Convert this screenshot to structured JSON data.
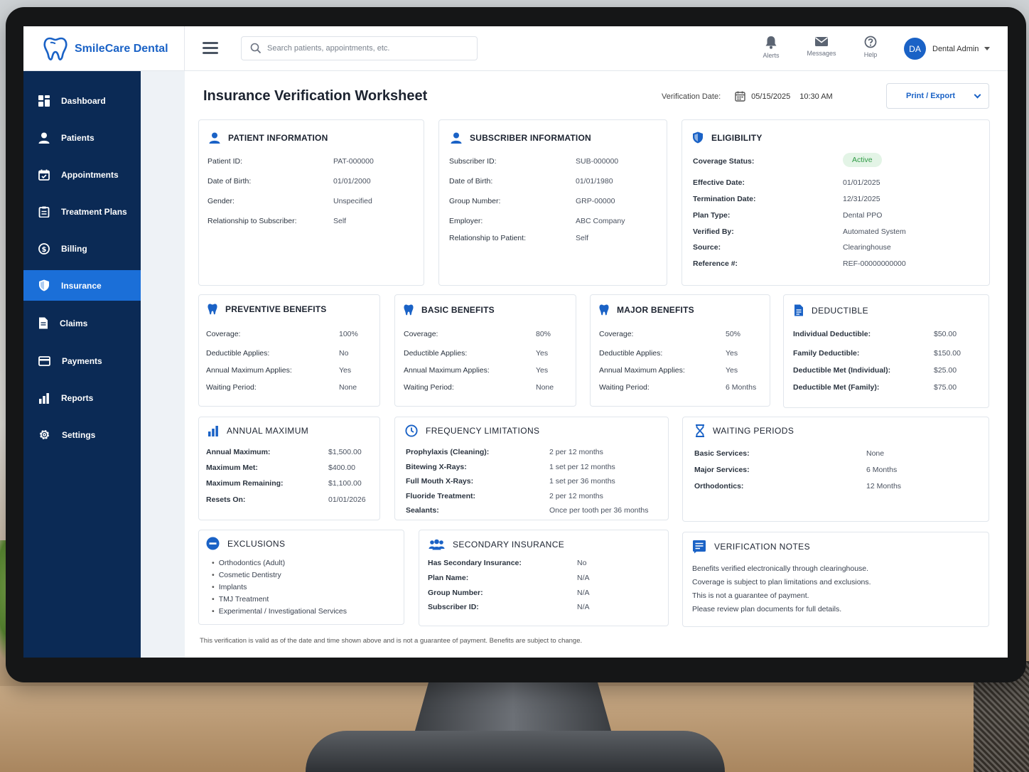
{
  "app": {
    "name": "SmileCare Dental"
  },
  "search": {
    "placeholder": "Search patients, appointments, etc."
  },
  "topbar": {
    "alerts_label": "Alerts",
    "messages_label": "Messages",
    "help_label": "Help",
    "user_initials": "DA",
    "user_name": "Dental Admin"
  },
  "sidebar": {
    "items": [
      {
        "label": "Dashboard",
        "icon": "dashboard-icon"
      },
      {
        "label": "Patients",
        "icon": "user-icon"
      },
      {
        "label": "Appointments",
        "icon": "calendar-icon"
      },
      {
        "label": "Treatment Plans",
        "icon": "clipboard-icon"
      },
      {
        "label": "Billing",
        "icon": "dollar-icon"
      },
      {
        "label": "Insurance",
        "icon": "shield-icon",
        "active": true
      },
      {
        "label": "Claims",
        "icon": "document-icon"
      },
      {
        "label": "Payments",
        "icon": "credit-card-icon"
      },
      {
        "label": "Reports",
        "icon": "bar-chart-icon"
      },
      {
        "label": "Settings",
        "icon": "gear-icon"
      }
    ]
  },
  "header": {
    "title": "Insurance Verification Worksheet",
    "verification_label": "Verification Date:",
    "verification_date": "05/15/2025",
    "verification_time": "10:30 AM",
    "export_label": "Print / Export"
  },
  "patient": {
    "title": "PATIENT INFORMATION",
    "rows": [
      {
        "k": "Patient ID:",
        "v": "PAT-000000"
      },
      {
        "k": "Date of Birth:",
        "v": "01/01/2000"
      },
      {
        "k": "Gender:",
        "v": "Unspecified"
      },
      {
        "k": "Relationship to Subscriber:",
        "v": "Self"
      }
    ]
  },
  "subscriber": {
    "title": "SUBSCRIBER INFORMATION",
    "rows": [
      {
        "k": "Subscriber ID:",
        "v": "SUB-000000"
      },
      {
        "k": "Date of Birth:",
        "v": "01/01/1980"
      },
      {
        "k": "Group Number:",
        "v": "GRP-00000"
      },
      {
        "k": "Employer:",
        "v": "ABC Company"
      },
      {
        "k": "Relationship to Patient:",
        "v": "Self"
      }
    ]
  },
  "eligibility": {
    "title": "ELIGIBILITY",
    "coverage_status_label": "Coverage Status:",
    "coverage_status": "Active",
    "rows": [
      {
        "k": "Effective Date:",
        "v": "01/01/2025"
      },
      {
        "k": "Termination Date:",
        "v": "12/31/2025"
      },
      {
        "k": "Plan Type:",
        "v": "Dental PPO"
      },
      {
        "k": "Verified By:",
        "v": "Automated System"
      },
      {
        "k": "Source:",
        "v": "Clearinghouse"
      },
      {
        "k": "Reference #:",
        "v": "REF-00000000000"
      }
    ]
  },
  "preventive": {
    "title": "PREVENTIVE BENEFITS",
    "rows": [
      {
        "k": "Coverage:",
        "v": "100%"
      },
      {
        "k": "Deductible Applies:",
        "v": "No"
      },
      {
        "k": "Annual Maximum Applies:",
        "v": "Yes"
      },
      {
        "k": "Waiting Period:",
        "v": "None"
      }
    ]
  },
  "basic": {
    "title": "BASIC BENEFITS",
    "rows": [
      {
        "k": "Coverage:",
        "v": "80%"
      },
      {
        "k": "Deductible Applies:",
        "v": "Yes"
      },
      {
        "k": "Annual Maximum Applies:",
        "v": "Yes"
      },
      {
        "k": "Waiting Period:",
        "v": "None"
      }
    ]
  },
  "major": {
    "title": "MAJOR BENEFITS",
    "rows": [
      {
        "k": "Coverage:",
        "v": "50%"
      },
      {
        "k": "Deductible Applies:",
        "v": "Yes"
      },
      {
        "k": "Annual Maximum Applies:",
        "v": "Yes"
      },
      {
        "k": "Waiting Period:",
        "v": "6 Months"
      }
    ]
  },
  "deductible": {
    "title": "DEDUCTIBLE",
    "rows": [
      {
        "k": "Individual Deductible:",
        "v": "$50.00"
      },
      {
        "k": "Family Deductible:",
        "v": "$150.00"
      },
      {
        "k": "Deductible Met (Individual):",
        "v": "$25.00"
      },
      {
        "k": "Deductible Met (Family):",
        "v": "$75.00"
      }
    ]
  },
  "annual_max": {
    "title": "ANNUAL MAXIMUM",
    "rows": [
      {
        "k": "Annual Maximum:",
        "v": "$1,500.00"
      },
      {
        "k": "Maximum Met:",
        "v": "$400.00"
      },
      {
        "k": "Maximum Remaining:",
        "v": "$1,100.00"
      },
      {
        "k": "Resets On:",
        "v": "01/01/2026"
      }
    ]
  },
  "frequency": {
    "title": "FREQUENCY LIMITATIONS",
    "rows": [
      {
        "k": "Prophylaxis (Cleaning):",
        "v": "2 per 12 months"
      },
      {
        "k": "Bitewing X-Rays:",
        "v": "1 set per 12 months"
      },
      {
        "k": "Full Mouth X-Rays:",
        "v": "1 set per 36 months"
      },
      {
        "k": "Fluoride Treatment:",
        "v": "2 per 12 months"
      },
      {
        "k": "Sealants:",
        "v": "Once per tooth per 36 months"
      }
    ]
  },
  "waiting": {
    "title": "WAITING PERIODS",
    "rows": [
      {
        "k": "Basic Services:",
        "v": "None"
      },
      {
        "k": "Major Services:",
        "v": "6 Months"
      },
      {
        "k": "Orthodontics:",
        "v": "12 Months"
      }
    ]
  },
  "exclusions": {
    "title": "EXCLUSIONS",
    "items": [
      "Orthodontics (Adult)",
      "Cosmetic Dentistry",
      "Implants",
      "TMJ Treatment",
      "Experimental / Investigational Services"
    ]
  },
  "secondary": {
    "title": "SECONDARY INSURANCE",
    "rows": [
      {
        "k": "Has Secondary Insurance:",
        "v": "No"
      },
      {
        "k": "Plan Name:",
        "v": "N/A"
      },
      {
        "k": "Group Number:",
        "v": "N/A"
      },
      {
        "k": "Subscriber ID:",
        "v": "N/A"
      }
    ]
  },
  "notes": {
    "title": "VERIFICATION NOTES",
    "lines": [
      "Benefits verified electronically through clearinghouse.",
      "Coverage is subject to plan limitations and exclusions.",
      "This is not a guarantee of payment.",
      "Please review plan documents for full details."
    ]
  },
  "footnote": "This verification is valid as of the date and time shown above and is not a guarantee of payment. Benefits are subject to change.",
  "colors": {
    "brand": "#1a62c6",
    "sidebar": "#0b2a55",
    "active": "#1b6fd8",
    "status_active": "#2f9a45"
  }
}
